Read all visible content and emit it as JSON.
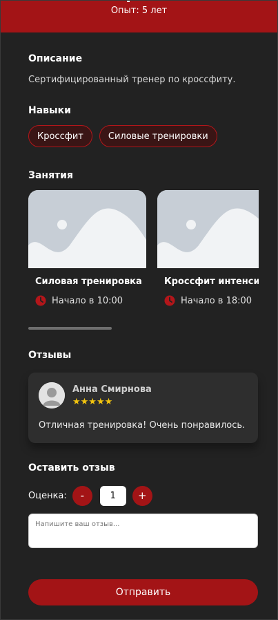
{
  "header": {
    "experience": "Опыт: 5 лет"
  },
  "description": {
    "title": "Описание",
    "text": "Сертифицированный тренер по кроссфиту."
  },
  "skills": {
    "title": "Навыки",
    "items": [
      "Кроссфит",
      "Силовые тренировки"
    ]
  },
  "classes": {
    "title": "Занятия",
    "items": [
      {
        "name": "Силовая тренировка",
        "time": "Начало в 10:00"
      },
      {
        "name": "Кроссфит интенсив",
        "time": "Начало в 18:00"
      }
    ]
  },
  "reviews": {
    "title": "Отзывы",
    "items": [
      {
        "author": "Анна Смирнова",
        "stars": "★★★★★",
        "text": "Отличная тренировка! Очень понравилось."
      }
    ]
  },
  "leave_review": {
    "title": "Оставить отзыв",
    "rating_label": "Оценка:",
    "minus_label": "-",
    "plus_label": "+",
    "rating_value": "1",
    "textarea_placeholder": "Напишите ваш отзыв...",
    "submit_label": "Отправить"
  },
  "colors": {
    "accent": "#a31416",
    "background": "#222222",
    "card": "#2e2e2e",
    "star": "#f2c40f"
  }
}
